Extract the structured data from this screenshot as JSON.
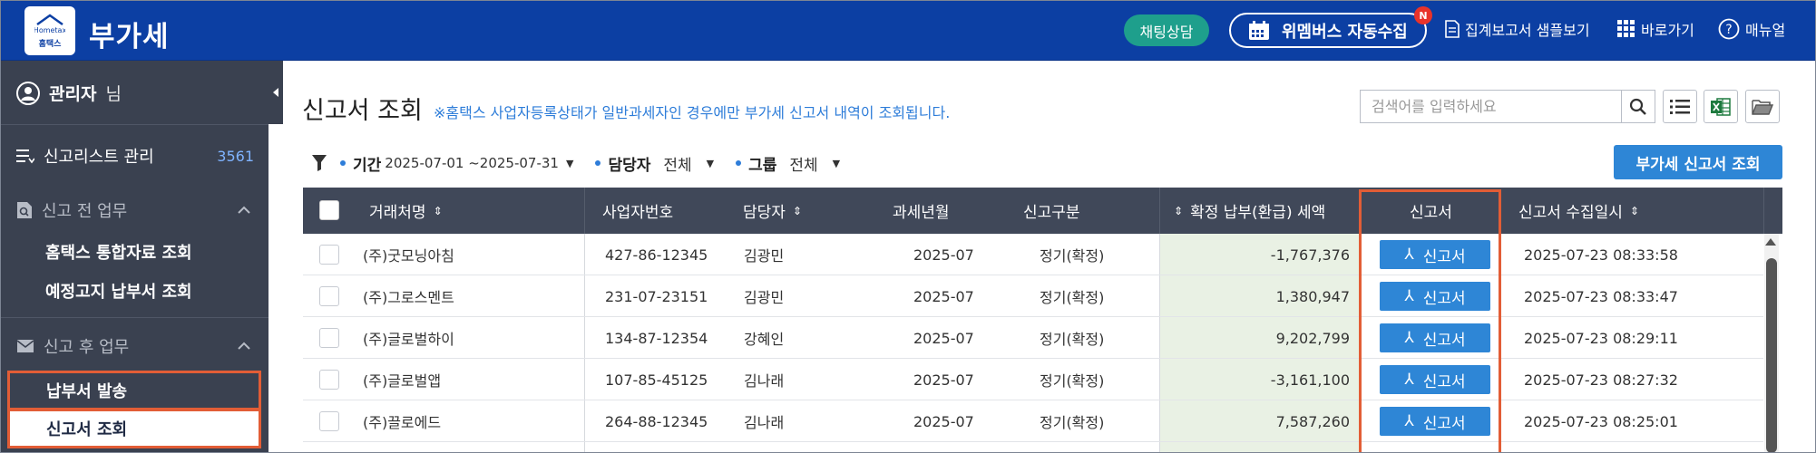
{
  "header": {
    "logo_text": "홈택스",
    "logo_label": "Hometax",
    "title": "부가세",
    "chat_label": "채팅상담",
    "wemembers_label": "위멤버스 자동수집",
    "new_badge": "N",
    "links": [
      {
        "label": "집계보고서 샘플보기",
        "icon": "document-icon"
      },
      {
        "label": "바로가기",
        "icon": "grid-icon"
      },
      {
        "label": "매뉴얼",
        "icon": "help-icon"
      }
    ],
    "colors": {
      "bar": "#0c3fa3",
      "chat": "#1e9f8c",
      "badge": "#e8332a"
    }
  },
  "sidebar": {
    "user_name": "관리자",
    "user_suffix": "님",
    "list_label": "신고리스트 관리",
    "list_count": "3561",
    "section_before": "신고 전 업무",
    "before_items": [
      "홈택스 통합자료 조회",
      "예정고지 납부서 조회"
    ],
    "section_after": "신고 후 업무",
    "after_items": [
      "납부서 발송",
      "신고서 조회"
    ]
  },
  "main": {
    "title": "신고서 조회",
    "notice": "※홈택스 사업자등록상태가 일반과세자인 경우에만 부가세 신고서 내역이 조회됩니다.",
    "search_placeholder": "검색어를 입력하세요",
    "filters": {
      "period_label": "기간",
      "period_value": "2025-07-01 ~2025-07-31",
      "manager_label": "담당자",
      "manager_value": "전체",
      "group_label": "그룹",
      "group_value": "전체"
    },
    "query_button": "부가세 신고서 조회"
  },
  "table": {
    "columns": [
      "거래처명",
      "사업자번호",
      "담당자",
      "과세년월",
      "신고구분",
      "확정 납부(환급) 세액",
      "신고서",
      "신고서 수집일시"
    ],
    "pdf_label": "신고서",
    "rows": [
      {
        "name": "(주)굿모닝아침",
        "biz_no": "427-86-12345",
        "manager": "김광민",
        "period": "2025-07",
        "type": "정기(확정)",
        "amount": "-1,767,376",
        "collected": "2025-07-23 08:33:58"
      },
      {
        "name": "(주)그로스멘트",
        "biz_no": "231-07-23151",
        "manager": "김광민",
        "period": "2025-07",
        "type": "정기(확정)",
        "amount": "1,380,947",
        "collected": "2025-07-23 08:33:47"
      },
      {
        "name": "(주)글로벌하이",
        "biz_no": "134-87-12354",
        "manager": "강혜인",
        "period": "2025-07",
        "type": "정기(확정)",
        "amount": "9,202,799",
        "collected": "2025-07-23 08:29:11"
      },
      {
        "name": "(주)글로벌앱",
        "biz_no": "107-85-45125",
        "manager": "김나래",
        "period": "2025-07",
        "type": "정기(확정)",
        "amount": "-3,161,100",
        "collected": "2025-07-23 08:27:32"
      },
      {
        "name": "(주)끌로에드",
        "biz_no": "264-88-12345",
        "manager": "김나래",
        "period": "2025-07",
        "type": "정기(확정)",
        "amount": "7,587,260",
        "collected": "2025-07-23 08:25:01"
      }
    ]
  },
  "colors": {
    "accent": "#2e86d6",
    "highlight": "#e25d36",
    "sidebar": "#3a4150",
    "table_header": "#404859",
    "amount_bg": "#e9f1e4"
  }
}
